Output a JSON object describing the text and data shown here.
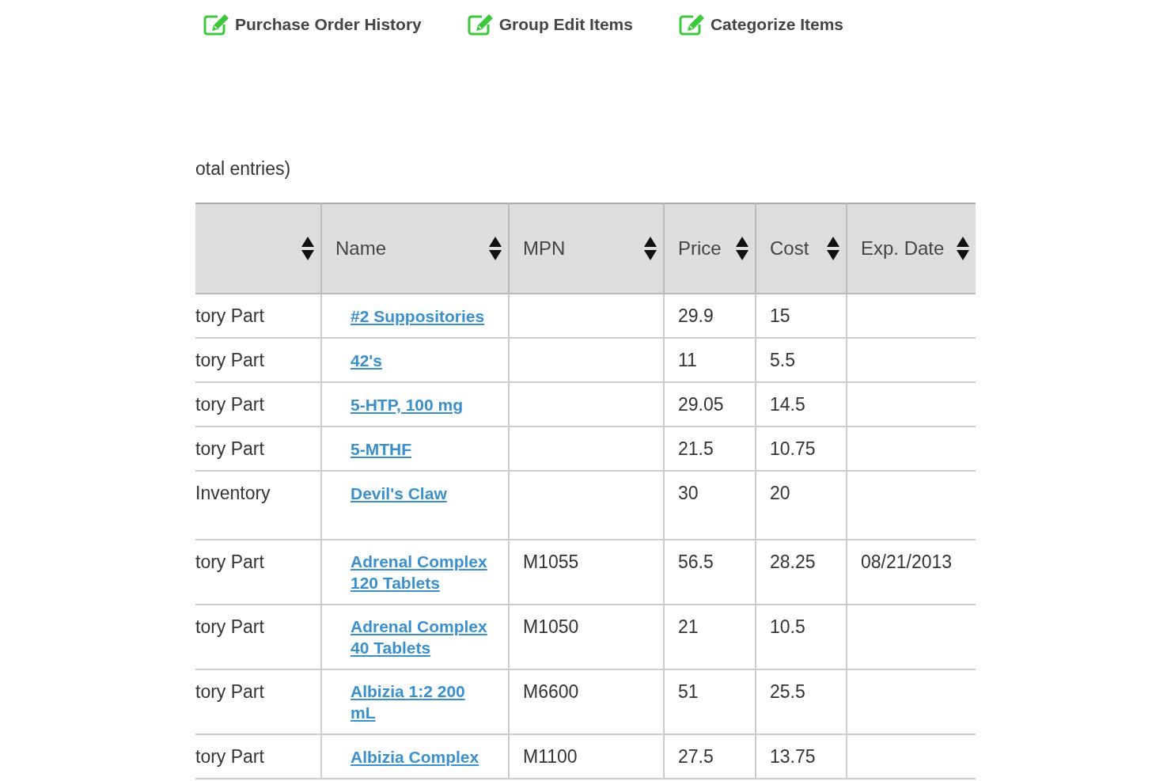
{
  "actions": [
    {
      "label": "Purchase Order History"
    },
    {
      "label": "Group Edit Items"
    },
    {
      "label": "Categorize Items"
    }
  ],
  "entries_text": "otal entries)",
  "table": {
    "columns": [
      {},
      {
        "label": "Name"
      },
      {
        "label": "MPN"
      },
      {
        "label": "Price"
      },
      {
        "label": "Cost"
      },
      {
        "label": "Exp. Date"
      }
    ],
    "rows": [
      {
        "type": "tory Part",
        "name": "#2 Suppositories",
        "mpn": "",
        "price": "29.9",
        "cost": "15",
        "exp": ""
      },
      {
        "type": "tory Part",
        "name": "42's",
        "mpn": "",
        "price": "11",
        "cost": "5.5",
        "exp": ""
      },
      {
        "type": "tory Part",
        "name": "5-HTP, 100 mg",
        "mpn": "",
        "price": "29.05",
        "cost": "14.5",
        "exp": ""
      },
      {
        "type": "tory Part",
        "name": "5-MTHF",
        "mpn": "",
        "price": "21.5",
        "cost": "10.75",
        "exp": ""
      },
      {
        "type": "Inventory",
        "name": "Devil's Claw",
        "mpn": "",
        "price": "30",
        "cost": "20",
        "exp": ""
      },
      {
        "type": "tory Part",
        "name": "Adrenal Complex 120 Tablets",
        "mpn": "M1055",
        "price": "56.5",
        "cost": "28.25",
        "exp": "08/21/2013"
      },
      {
        "type": "tory Part",
        "name": "Adrenal Complex 40 Tablets",
        "mpn": "M1050",
        "price": "21",
        "cost": "10.5",
        "exp": ""
      },
      {
        "type": "tory Part",
        "name": "Albizia 1:2 200 mL",
        "mpn": "M6600",
        "price": "51",
        "cost": "25.5",
        "exp": ""
      },
      {
        "type": "tory Part",
        "name": "Albizia Complex",
        "mpn": "M1100",
        "price": "27.5",
        "cost": "13.75",
        "exp": ""
      }
    ]
  }
}
